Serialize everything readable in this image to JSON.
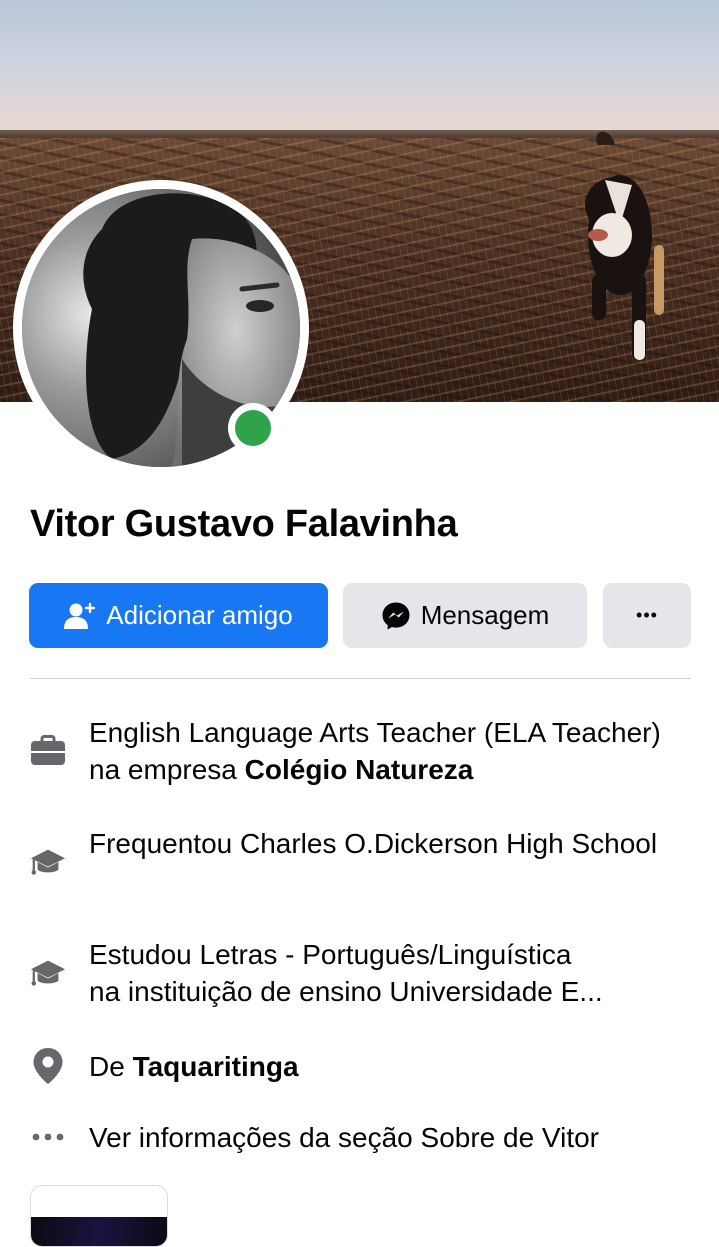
{
  "profile": {
    "name": "Vitor Gustavo Falavinha",
    "online": true
  },
  "actions": {
    "add_friend": "Adicionar amigo",
    "message": "Mensagem",
    "more": "•••"
  },
  "details": {
    "work": {
      "icon": "briefcase-icon",
      "prefix": "English Language Arts Teacher (ELA Teacher) na empresa ",
      "bold": "Colégio Natureza"
    },
    "highschool": {
      "icon": "graduation-cap-icon",
      "text": "Frequentou Charles O.Dickerson High School"
    },
    "college": {
      "icon": "graduation-cap-icon",
      "line1": "Estudou Letras - Português/Linguística",
      "line2": "na instituição de ensino Universidade E..."
    },
    "hometown": {
      "icon": "location-pin-icon",
      "prefix": "De ",
      "bold": "Taquaritinga"
    },
    "about_link": {
      "icon": "more-dots-icon",
      "text": "Ver informações da seção Sobre de Vitor"
    }
  },
  "colors": {
    "primary": "#1877f2",
    "secondary_button": "#e4e6eb",
    "online": "#31a24c",
    "icon_gray": "#65676b"
  }
}
